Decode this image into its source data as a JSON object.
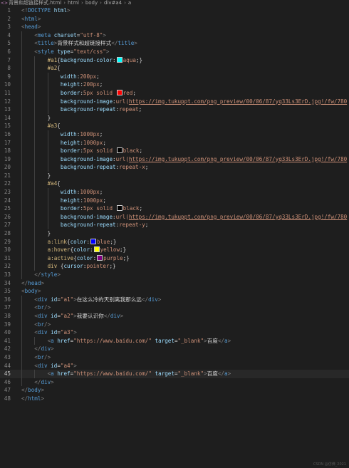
{
  "breadcrumb": {
    "file": "背景和超链接样式.html",
    "items": [
      "html",
      "body",
      "div#a4",
      "a"
    ]
  },
  "colors": {
    "aqua": "#00ffff",
    "red": "#ff0000",
    "black": "#000000",
    "blue": "#0000ff",
    "yellow": "#ffff00",
    "purple": "#800080"
  },
  "lines": [
    {
      "n": "1",
      "indent": 0,
      "tokens": [
        [
          "punct",
          "<!"
        ],
        [
          "tag",
          "DOCTYPE"
        ],
        [
          "text",
          " "
        ],
        [
          "attr",
          "html"
        ],
        [
          "punct",
          ">"
        ]
      ]
    },
    {
      "n": "2",
      "indent": 0,
      "tokens": [
        [
          "punct",
          "<"
        ],
        [
          "tag",
          "html"
        ],
        [
          "punct",
          ">"
        ]
      ]
    },
    {
      "n": "3",
      "indent": 0,
      "tokens": [
        [
          "punct",
          "<"
        ],
        [
          "tag",
          "head"
        ],
        [
          "punct",
          ">"
        ]
      ]
    },
    {
      "n": "4",
      "indent": 1,
      "tokens": [
        [
          "punct",
          "<"
        ],
        [
          "tag",
          "meta"
        ],
        [
          "text",
          " "
        ],
        [
          "attr",
          "charset"
        ],
        [
          "text",
          "="
        ],
        [
          "str",
          "\"utf-8\""
        ],
        [
          "punct",
          ">"
        ]
      ]
    },
    {
      "n": "5",
      "indent": 1,
      "tokens": [
        [
          "punct",
          "<"
        ],
        [
          "tag",
          "title"
        ],
        [
          "punct",
          ">"
        ],
        [
          "text",
          "背景样式和超链接样式"
        ],
        [
          "punct",
          "</"
        ],
        [
          "tag",
          "title"
        ],
        [
          "punct",
          ">"
        ]
      ]
    },
    {
      "n": "6",
      "indent": 1,
      "tokens": [
        [
          "punct",
          "<"
        ],
        [
          "tag",
          "style"
        ],
        [
          "text",
          " "
        ],
        [
          "attr",
          "type"
        ],
        [
          "text",
          "="
        ],
        [
          "str",
          "\"text/css\""
        ],
        [
          "punct",
          ">"
        ]
      ]
    },
    {
      "n": "7",
      "indent": 2,
      "tokens": [
        [
          "sel",
          "#a1"
        ],
        [
          "text",
          "{"
        ],
        [
          "prop",
          "background-color"
        ],
        [
          "text",
          ":"
        ],
        [
          "swatch",
          "aqua"
        ],
        [
          "val",
          "aqua"
        ],
        [
          "text",
          ";}"
        ]
      ]
    },
    {
      "n": "8",
      "indent": 2,
      "tokens": [
        [
          "sel",
          "#a2"
        ],
        [
          "text",
          "{"
        ]
      ]
    },
    {
      "n": "9",
      "indent": 3,
      "tokens": [
        [
          "prop",
          "width"
        ],
        [
          "text",
          ":"
        ],
        [
          "val",
          "200px"
        ],
        [
          "text",
          ";"
        ]
      ]
    },
    {
      "n": "10",
      "indent": 3,
      "tokens": [
        [
          "prop",
          "height"
        ],
        [
          "text",
          ":"
        ],
        [
          "val",
          "200px"
        ],
        [
          "text",
          ";"
        ]
      ]
    },
    {
      "n": "11",
      "indent": 3,
      "tokens": [
        [
          "prop",
          "border"
        ],
        [
          "text",
          ":"
        ],
        [
          "val",
          "5px solid "
        ],
        [
          "swatch",
          "red"
        ],
        [
          "val",
          "red"
        ],
        [
          "text",
          ";"
        ]
      ]
    },
    {
      "n": "12",
      "indent": 3,
      "tokens": [
        [
          "prop",
          "background-image"
        ],
        [
          "text",
          ":"
        ],
        [
          "val",
          "url("
        ],
        [
          "url",
          "https://img.tukuppt.com/png_preview/00/06/87/yq33Ls3ErD.jpg!/fw/780"
        ]
      ]
    },
    {
      "n": "13",
      "indent": 3,
      "tokens": [
        [
          "prop",
          "background-repeat"
        ],
        [
          "text",
          ":"
        ],
        [
          "val",
          "repeat"
        ],
        [
          "text",
          ";"
        ]
      ]
    },
    {
      "n": "14",
      "indent": 2,
      "tokens": [
        [
          "text",
          "}"
        ]
      ]
    },
    {
      "n": "15",
      "indent": 2,
      "tokens": [
        [
          "sel",
          "#a3"
        ],
        [
          "text",
          "{"
        ]
      ]
    },
    {
      "n": "16",
      "indent": 3,
      "tokens": [
        [
          "prop",
          "width"
        ],
        [
          "text",
          ":"
        ],
        [
          "val",
          "1000px"
        ],
        [
          "text",
          ";"
        ]
      ]
    },
    {
      "n": "17",
      "indent": 3,
      "tokens": [
        [
          "prop",
          "height"
        ],
        [
          "text",
          ":"
        ],
        [
          "val",
          "1000px"
        ],
        [
          "text",
          ";"
        ]
      ]
    },
    {
      "n": "18",
      "indent": 3,
      "tokens": [
        [
          "prop",
          "border"
        ],
        [
          "text",
          ":"
        ],
        [
          "val",
          "5px solid "
        ],
        [
          "swatch",
          "black"
        ],
        [
          "val",
          "black"
        ],
        [
          "text",
          ";"
        ]
      ]
    },
    {
      "n": "19",
      "indent": 3,
      "tokens": [
        [
          "prop",
          "background-image"
        ],
        [
          "text",
          ":"
        ],
        [
          "val",
          "url("
        ],
        [
          "url",
          "https://img.tukuppt.com/png_preview/00/06/87/yq33Ls3ErD.jpg!/fw/780"
        ]
      ]
    },
    {
      "n": "20",
      "indent": 3,
      "tokens": [
        [
          "prop",
          "background-repeat"
        ],
        [
          "text",
          ":"
        ],
        [
          "val",
          "repeat-x"
        ],
        [
          "text",
          ";"
        ]
      ]
    },
    {
      "n": "21",
      "indent": 2,
      "tokens": [
        [
          "text",
          "}"
        ]
      ]
    },
    {
      "n": "22",
      "indent": 2,
      "tokens": [
        [
          "sel",
          "#a4"
        ],
        [
          "text",
          "{"
        ]
      ]
    },
    {
      "n": "23",
      "indent": 3,
      "tokens": [
        [
          "prop",
          "width"
        ],
        [
          "text",
          ":"
        ],
        [
          "val",
          "1000px"
        ],
        [
          "text",
          ";"
        ]
      ]
    },
    {
      "n": "24",
      "indent": 3,
      "tokens": [
        [
          "prop",
          "height"
        ],
        [
          "text",
          ":"
        ],
        [
          "val",
          "1000px"
        ],
        [
          "text",
          ";"
        ]
      ]
    },
    {
      "n": "25",
      "indent": 3,
      "tokens": [
        [
          "prop",
          "border"
        ],
        [
          "text",
          ":"
        ],
        [
          "val",
          "5px solid "
        ],
        [
          "swatch",
          "black"
        ],
        [
          "val",
          "black"
        ],
        [
          "text",
          ";"
        ]
      ]
    },
    {
      "n": "26",
      "indent": 3,
      "tokens": [
        [
          "prop",
          "background-image"
        ],
        [
          "text",
          ":"
        ],
        [
          "val",
          "url("
        ],
        [
          "url",
          "https://img.tukuppt.com/png_preview/00/06/87/yq33Ls3ErD.jpg!/fw/780"
        ]
      ]
    },
    {
      "n": "27",
      "indent": 3,
      "tokens": [
        [
          "prop",
          "background-repeat"
        ],
        [
          "text",
          ":"
        ],
        [
          "val",
          "repeat-y"
        ],
        [
          "text",
          ";"
        ]
      ]
    },
    {
      "n": "28",
      "indent": 2,
      "tokens": [
        [
          "text",
          "}"
        ]
      ]
    },
    {
      "n": "29",
      "indent": 2,
      "tokens": [
        [
          "sel",
          "a:link"
        ],
        [
          "text",
          "{"
        ],
        [
          "prop",
          "color"
        ],
        [
          "text",
          ":"
        ],
        [
          "swatch",
          "blue"
        ],
        [
          "val",
          "blue"
        ],
        [
          "text",
          ";}"
        ]
      ]
    },
    {
      "n": "30",
      "indent": 2,
      "tokens": [
        [
          "sel",
          "a:hover"
        ],
        [
          "text",
          "{"
        ],
        [
          "prop",
          "color"
        ],
        [
          "text",
          ":"
        ],
        [
          "swatch",
          "yellow"
        ],
        [
          "val",
          "yellow"
        ],
        [
          "text",
          ";}"
        ]
      ]
    },
    {
      "n": "31",
      "indent": 2,
      "tokens": [
        [
          "sel",
          "a:active"
        ],
        [
          "text",
          "{"
        ],
        [
          "prop",
          "color"
        ],
        [
          "text",
          ":"
        ],
        [
          "swatch",
          "purple"
        ],
        [
          "val",
          "purple"
        ],
        [
          "text",
          ";}"
        ]
      ]
    },
    {
      "n": "32",
      "indent": 2,
      "tokens": [
        [
          "sel",
          "div"
        ],
        [
          "text",
          " {"
        ],
        [
          "prop",
          "cursor"
        ],
        [
          "text",
          ":"
        ],
        [
          "val",
          "pointer"
        ],
        [
          "text",
          ";}"
        ]
      ]
    },
    {
      "n": "33",
      "indent": 1,
      "tokens": [
        [
          "punct",
          "</"
        ],
        [
          "tag",
          "style"
        ],
        [
          "punct",
          ">"
        ]
      ]
    },
    {
      "n": "34",
      "indent": 0,
      "tokens": [
        [
          "punct",
          "</"
        ],
        [
          "tag",
          "head"
        ],
        [
          "punct",
          ">"
        ]
      ]
    },
    {
      "n": "35",
      "indent": 0,
      "tokens": [
        [
          "punct",
          "<"
        ],
        [
          "tag",
          "body"
        ],
        [
          "punct",
          ">"
        ]
      ]
    },
    {
      "n": "36",
      "indent": 1,
      "tokens": [
        [
          "punct",
          "<"
        ],
        [
          "tag",
          "div"
        ],
        [
          "text",
          " "
        ],
        [
          "attr",
          "id"
        ],
        [
          "text",
          "="
        ],
        [
          "str",
          "\"a1\""
        ],
        [
          "punct",
          ">"
        ],
        [
          "text",
          "在这么冷的天别离我那么远"
        ],
        [
          "punct",
          "</"
        ],
        [
          "tag",
          "div"
        ],
        [
          "punct",
          ">"
        ]
      ]
    },
    {
      "n": "37",
      "indent": 1,
      "tokens": [
        [
          "punct",
          "<"
        ],
        [
          "tag",
          "br"
        ],
        [
          "punct",
          "/>"
        ]
      ]
    },
    {
      "n": "38",
      "indent": 1,
      "tokens": [
        [
          "punct",
          "<"
        ],
        [
          "tag",
          "div"
        ],
        [
          "text",
          " "
        ],
        [
          "attr",
          "id"
        ],
        [
          "text",
          "="
        ],
        [
          "str",
          "\"a2\""
        ],
        [
          "punct",
          ">"
        ],
        [
          "text",
          "我要认识你"
        ],
        [
          "punct",
          "</"
        ],
        [
          "tag",
          "div"
        ],
        [
          "punct",
          ">"
        ]
      ]
    },
    {
      "n": "39",
      "indent": 1,
      "tokens": [
        [
          "punct",
          "<"
        ],
        [
          "tag",
          "br"
        ],
        [
          "punct",
          "/>"
        ]
      ]
    },
    {
      "n": "40",
      "indent": 1,
      "tokens": [
        [
          "punct",
          "<"
        ],
        [
          "tag",
          "div"
        ],
        [
          "text",
          " "
        ],
        [
          "attr",
          "id"
        ],
        [
          "text",
          "="
        ],
        [
          "str",
          "\"a3\""
        ],
        [
          "punct",
          ">"
        ]
      ]
    },
    {
      "n": "41",
      "indent": 2,
      "tokens": [
        [
          "punct",
          "<"
        ],
        [
          "tag",
          "a"
        ],
        [
          "text",
          " "
        ],
        [
          "attr",
          "href"
        ],
        [
          "text",
          "="
        ],
        [
          "str",
          "\"https://www.baidu.com/\""
        ],
        [
          "text",
          " "
        ],
        [
          "attr",
          "target"
        ],
        [
          "text",
          "="
        ],
        [
          "str",
          "\"_blank\""
        ],
        [
          "punct",
          ">"
        ],
        [
          "text",
          "百度"
        ],
        [
          "punct",
          "</"
        ],
        [
          "tag",
          "a"
        ],
        [
          "punct",
          ">"
        ]
      ]
    },
    {
      "n": "42",
      "indent": 1,
      "tokens": [
        [
          "punct",
          "</"
        ],
        [
          "tag",
          "div"
        ],
        [
          "punct",
          ">"
        ]
      ]
    },
    {
      "n": "43",
      "indent": 1,
      "tokens": [
        [
          "punct",
          "<"
        ],
        [
          "tag",
          "br"
        ],
        [
          "punct",
          "/>"
        ]
      ]
    },
    {
      "n": "44",
      "indent": 1,
      "tokens": [
        [
          "punct",
          "<"
        ],
        [
          "tag",
          "div"
        ],
        [
          "text",
          " "
        ],
        [
          "attr",
          "id"
        ],
        [
          "text",
          "="
        ],
        [
          "str",
          "\"a4\""
        ],
        [
          "punct",
          ">"
        ]
      ]
    },
    {
      "n": "45",
      "indent": 2,
      "current": true,
      "tokens": [
        [
          "punct",
          "<"
        ],
        [
          "tag",
          "a"
        ],
        [
          "text",
          " "
        ],
        [
          "attr",
          "href"
        ],
        [
          "text",
          "="
        ],
        [
          "str",
          "\"https://www.baidu.com/\""
        ],
        [
          "text",
          " "
        ],
        [
          "attr",
          "target"
        ],
        [
          "text",
          "="
        ],
        [
          "str",
          "\"_blank\""
        ],
        [
          "punct",
          ">"
        ],
        [
          "text",
          "百度"
        ],
        [
          "punct",
          "</"
        ],
        [
          "tag",
          "a"
        ],
        [
          "punct",
          ">"
        ]
      ]
    },
    {
      "n": "46",
      "indent": 1,
      "tokens": [
        [
          "punct",
          "</"
        ],
        [
          "tag",
          "div"
        ],
        [
          "punct",
          ">"
        ]
      ]
    },
    {
      "n": "47",
      "indent": 0,
      "tokens": [
        [
          "punct",
          "</"
        ],
        [
          "tag",
          "body"
        ],
        [
          "punct",
          ">"
        ]
      ]
    },
    {
      "n": "48",
      "indent": 0,
      "tokens": [
        [
          "punct",
          "</"
        ],
        [
          "tag",
          "html"
        ],
        [
          "punct",
          ">"
        ]
      ]
    }
  ],
  "watermark": "CSDN @仿佛_2021"
}
